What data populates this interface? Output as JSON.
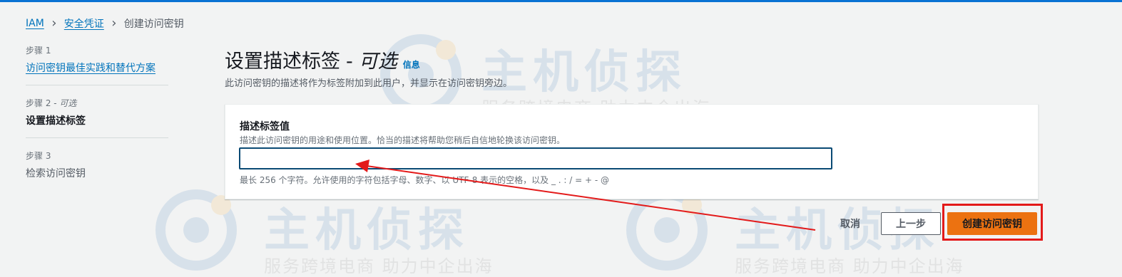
{
  "breadcrumb": {
    "root": "IAM",
    "parent": "安全凭证",
    "current": "创建访问密钥"
  },
  "steps": [
    {
      "number": "步骤 1",
      "label": "访问密钥最佳实践和替代方案"
    },
    {
      "number": "步骤 2 - ",
      "optional": "可选",
      "label": "设置描述标签"
    },
    {
      "number": "步骤 3",
      "label": "检索访问密钥"
    }
  ],
  "header": {
    "title": "设置描述标签",
    "separator": "-",
    "optional": "可选",
    "info": "信息",
    "description": "此访问密钥的描述将作为标签附加到此用户，并显示在访问密钥旁边。"
  },
  "form": {
    "label": "描述标签值",
    "description": "描述此访问密钥的用途和使用位置。恰当的描述将帮助您稍后自信地轮换该访问密钥。",
    "value": "",
    "constraint": "最长 256 个字符。允许使用的字符包括字母、数字、以 UTF-8 表示的空格，以及 _ . : / = + - @"
  },
  "actions": {
    "cancel": "取消",
    "previous": "上一步",
    "create": "创建访问密钥"
  },
  "watermark": {
    "brand": "主机侦探",
    "slogan": "服务跨境电商 助力中企出海"
  },
  "colors": {
    "link": "#0073bb",
    "primary_button": "#ec7211",
    "annotation": "#e31a1a",
    "input_focus": "#0a4a74"
  }
}
